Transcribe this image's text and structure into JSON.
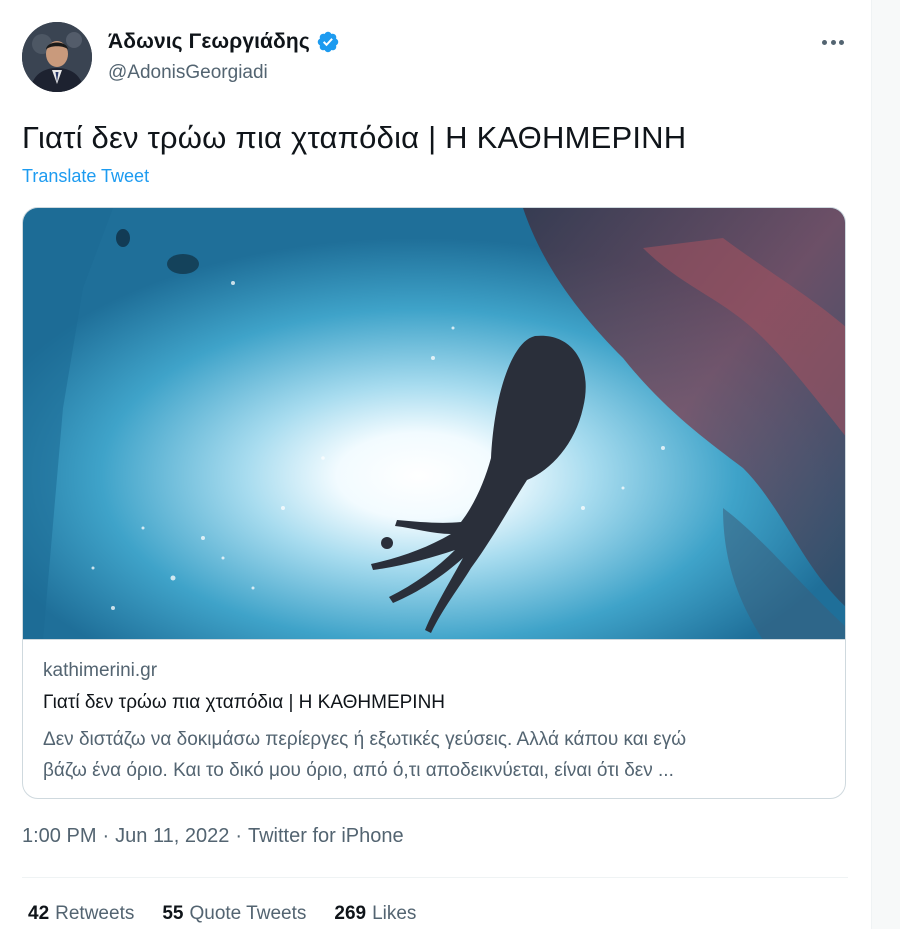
{
  "author": {
    "display_name": "Άδωνις Γεωργιάδης",
    "handle": "@AdonisGeorgiadi",
    "verified_icon": "verified-badge-icon",
    "avatar_icon": "profile-photo"
  },
  "tweet": {
    "text": "Γιατί δεν τρώω πια χταπόδια | Η ΚΑΘΗΜΕΡΙΝΗ",
    "translate_label": "Translate Tweet"
  },
  "card": {
    "image_description_icon": "octopus-underwater-photo",
    "domain": "kathimerini.gr",
    "title": "Γιατί δεν τρώω πια χταπόδια | Η ΚΑΘΗΜΕΡΙΝΗ",
    "description_line1": "Δεν διστάζω να δοκιμάσω περίεργες ή εξωτικές γεύσεις. Αλλά κάπου και εγώ",
    "description_line2": "βάζω ένα όριο. Και το δικό μου όριο, από ό,τι αποδεικνύεται, είναι ότι δεν ..."
  },
  "meta": {
    "time": "1:00 PM",
    "date": "Jun 11, 2022",
    "source": "Twitter for iPhone",
    "separator": "·"
  },
  "stats": {
    "retweets_count": "42",
    "retweets_label": "Retweets",
    "quotes_count": "55",
    "quotes_label": "Quote Tweets",
    "likes_count": "269",
    "likes_label": "Likes"
  },
  "colors": {
    "link": "#1d9bf0",
    "secondary_text": "#536471",
    "primary_text": "#0f1419"
  }
}
